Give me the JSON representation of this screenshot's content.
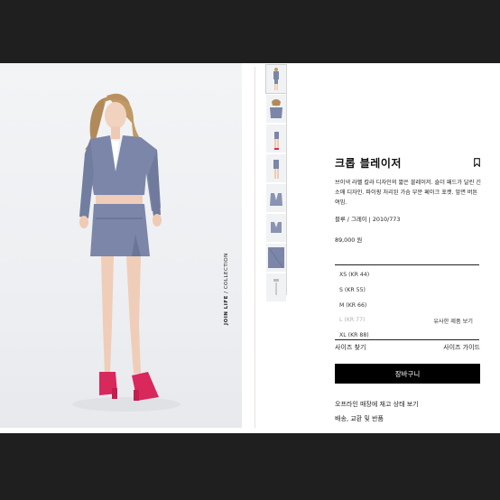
{
  "hero": {
    "image_alt": "model-wearing-cropped-blazer",
    "side_label_bold": "JOIN LIFE",
    "side_label_rest": " / COLLECTION"
  },
  "thumbnails": [
    {
      "name": "thumb-1"
    },
    {
      "name": "thumb-2"
    },
    {
      "name": "thumb-3"
    },
    {
      "name": "thumb-4"
    },
    {
      "name": "thumb-5"
    },
    {
      "name": "thumb-6"
    },
    {
      "name": "thumb-7"
    },
    {
      "name": "thumb-8"
    }
  ],
  "product": {
    "title": "크롭 블레이저",
    "description": "브이넥 라펠 칼라 디자인의 짧은 블레이저. 숄더 패드가 달린 긴소매 디자인. 파이핑 처리된 가슴 부분 페이크 포켓. 앞면 버튼 여밈.",
    "color_line": "블루 / 그레이 | 2010/773",
    "price": "89,000 원"
  },
  "sizes": [
    {
      "label": "XS (KR 44)",
      "available": true
    },
    {
      "label": "S (KR 55)",
      "available": true
    },
    {
      "label": "M (KR 66)",
      "available": true
    },
    {
      "label": "L (KR 77)",
      "available": false
    },
    {
      "label": "XL (KR 88)",
      "available": true
    }
  ],
  "similar_label": "유사한 제품 보기",
  "size_finder": "사이즈 찾기",
  "size_guide": "사이즈 가이드",
  "cart_button": "장바구니",
  "stock_link": "오프라인 매장에 재고 상태 보기",
  "shipping_link": "배송, 교환 및 반품",
  "colors": {
    "background": "#1f1f1f",
    "blazer": "#7b86a8",
    "sandals": "#d8285c",
    "button": "#000000"
  },
  "icons": {
    "bookmark": "bookmark-icon"
  }
}
